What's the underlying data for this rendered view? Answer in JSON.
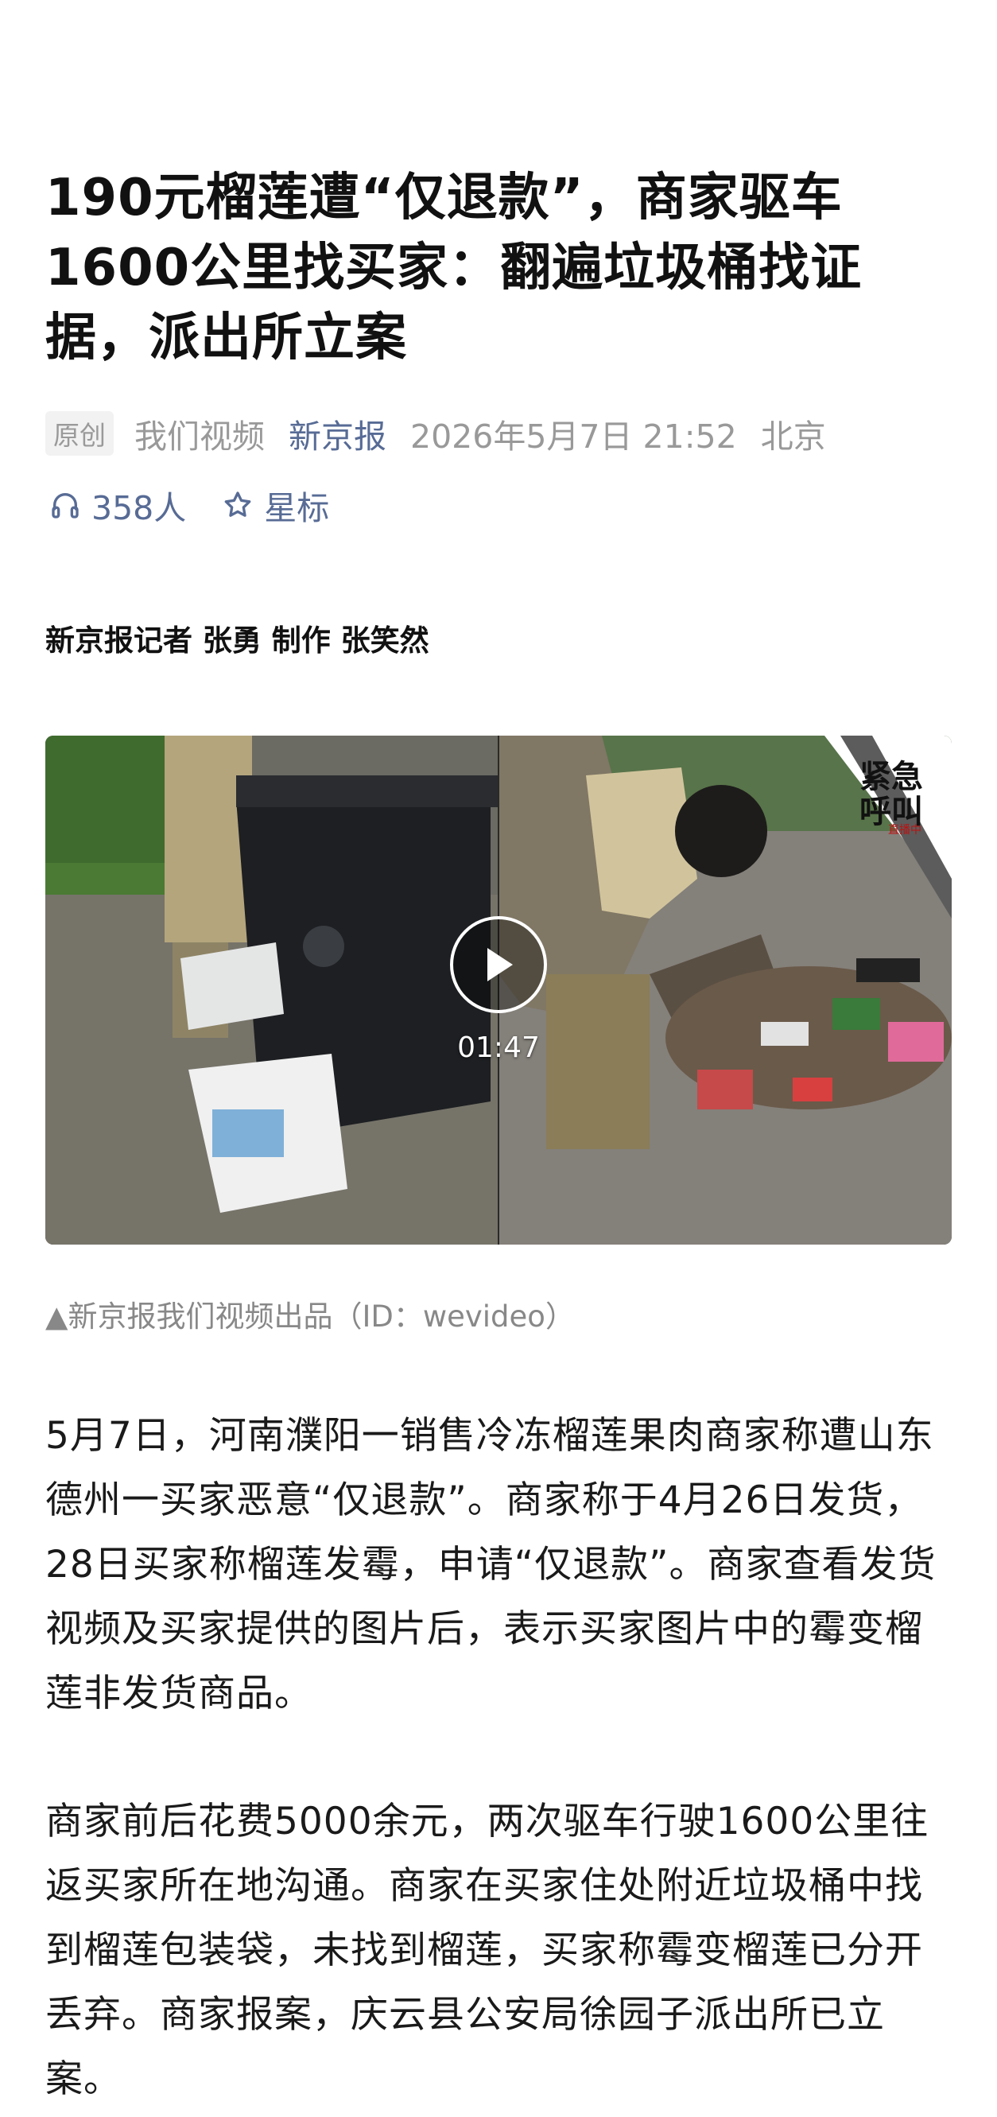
{
  "article": {
    "title": "190元榴莲遭“仅退款”，商家驱车1600公里找买家：翻遍垃圾桶找证据，派出所立案",
    "tag": "原创",
    "author": "我们视频",
    "source": "新京报",
    "date": "2026年5月7日 21:52",
    "location": "北京",
    "listeners": "358人",
    "star_label": "星标",
    "credit": "新京报记者 张勇 制作 张笑然",
    "video": {
      "duration": "01:47",
      "watermark": "紧急呼叫",
      "watermark_small": "直播中"
    },
    "caption": "▲新京报我们视频出品（ID：wevideo）",
    "paragraphs": [
      "5月7日，河南濮阳一销售冷冻榴莲果肉商家称遭山东德州一买家恶意“仅退款”。商家称于4月26日发货，28日买家称榴莲发霉，申请“仅退款”。商家查看发货视频及买家提供的图片后，表示买家图片中的霉变榴莲非发货商品。",
      "商家前后花费5000余元，两次驱车行驶1600公里往返买家所在地沟通。商家在买家住处附近垃圾桶中找到榴莲包装袋，未找到榴莲，买家称霉变榴莲已分开丢弃。商家报案，庆云县公安局徐园子派出所已立案。"
    ]
  },
  "colors": {
    "link": "#576b95",
    "meta": "#999999",
    "text": "#1a1a1a"
  },
  "icons": [
    "headphones-icon",
    "star-icon",
    "play-icon"
  ]
}
